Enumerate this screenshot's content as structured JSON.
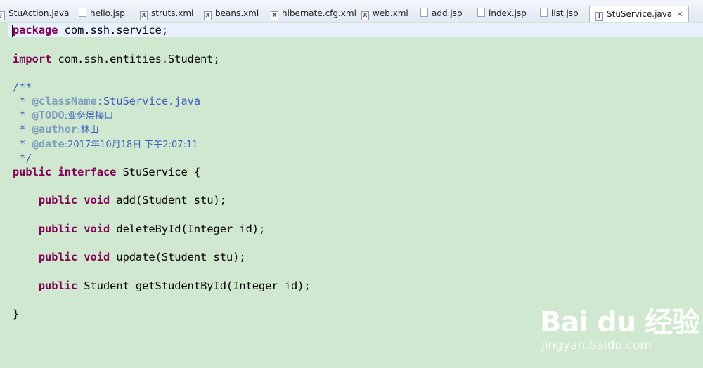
{
  "tabs": [
    {
      "label": "StuAction.java",
      "type": "java"
    },
    {
      "label": "hello.jsp",
      "type": "jsp"
    },
    {
      "label": "struts.xml",
      "type": "xml"
    },
    {
      "label": "beans.xml",
      "type": "xml"
    },
    {
      "label": "hibernate.cfg.xml",
      "type": "xml"
    },
    {
      "label": "web.xml",
      "type": "xml"
    },
    {
      "label": "add.jsp",
      "type": "jsp"
    },
    {
      "label": "index.jsp",
      "type": "jsp"
    },
    {
      "label": "list.jsp",
      "type": "jsp"
    },
    {
      "label": "StuService.java",
      "type": "java",
      "active": true
    }
  ],
  "tab_close_glyph": "✕",
  "icons": {
    "java": "J",
    "xml": "X",
    "jsp": ""
  },
  "code": {
    "l1_kw": "package",
    "l1_rest": " com.ssh.service;",
    "l3_kw": "import",
    "l3_rest": " com.ssh.entities.Student;",
    "l5": "/**",
    "l6_star": " * ",
    "l6_tag": "@className",
    "l6_rest": ":StuService.java",
    "l7_star": " * ",
    "l7_tag": "@TODO",
    "l7_rest": ":业务层接口",
    "l8_star": " * ",
    "l8_tag": "@author",
    "l8_rest": ":林山",
    "l9_star": " * ",
    "l9_tag": "@date",
    "l9_rest": ":2017年10月18日 下午2:07:11",
    "l10": " */",
    "l11_kw1": "public",
    "l11_kw2": "interface",
    "l11_rest": " StuService {",
    "m1_kw1": "public",
    "m1_kw2": "void",
    "m1_rest": " add(Student stu);",
    "m2_kw1": "public",
    "m2_kw2": "void",
    "m2_rest": " deleteById(Integer id);",
    "m3_kw1": "public",
    "m3_kw2": "void",
    "m3_rest": " update(Student stu);",
    "m4_kw1": "public",
    "m4_rest": " Student getStudentById(Integer id);",
    "close": "}"
  },
  "watermark": {
    "main": "Bai du 经验",
    "sub": "jingyan.baidu.com"
  },
  "colors": {
    "keyword": "#7f0055",
    "comment": "#3f5fbf",
    "doc_tag": "#7f9fbf",
    "editor_bg": "#cfe8cf",
    "current_line": "#e9f1ff"
  }
}
